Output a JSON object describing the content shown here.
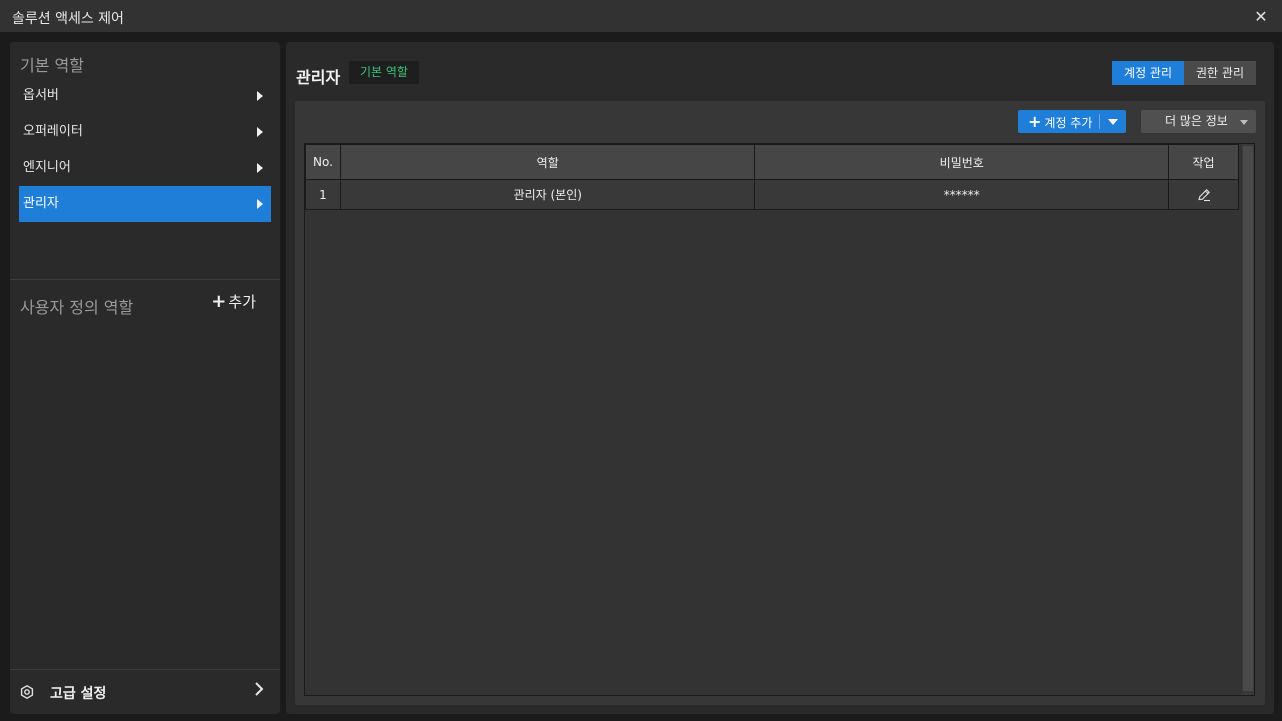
{
  "window": {
    "title": "솔루션 액세스 제어",
    "close_icon": "close-icon"
  },
  "sidebar": {
    "default_roles_title": "기본 역할",
    "roles": [
      {
        "label": "옵서버",
        "active": false
      },
      {
        "label": "오퍼레이터",
        "active": false
      },
      {
        "label": "엔지니어",
        "active": false
      },
      {
        "label": "관리자",
        "active": true
      }
    ],
    "custom_roles_title": "사용자 정의 역할",
    "add_label": "추가",
    "advanced_settings_label": "고급 설정"
  },
  "main": {
    "title": "관리자",
    "badge": "기본 역할",
    "tabs": [
      {
        "label": "계정 관리",
        "active": true
      },
      {
        "label": "권한 관리",
        "active": false
      }
    ],
    "add_account_label": "계정 추가",
    "more_info_label": "더 많은 정보",
    "table": {
      "headers": [
        "No.",
        "역할",
        "비밀번호",
        "작업"
      ],
      "rows": [
        {
          "no": "1",
          "role": "관리자 (본인)",
          "password": "******"
        }
      ]
    }
  },
  "colors": {
    "accent": "#1f7ed8",
    "badge_text": "#3ec07a",
    "background": "#1b1b1b",
    "panel": "#2a2a2a"
  }
}
